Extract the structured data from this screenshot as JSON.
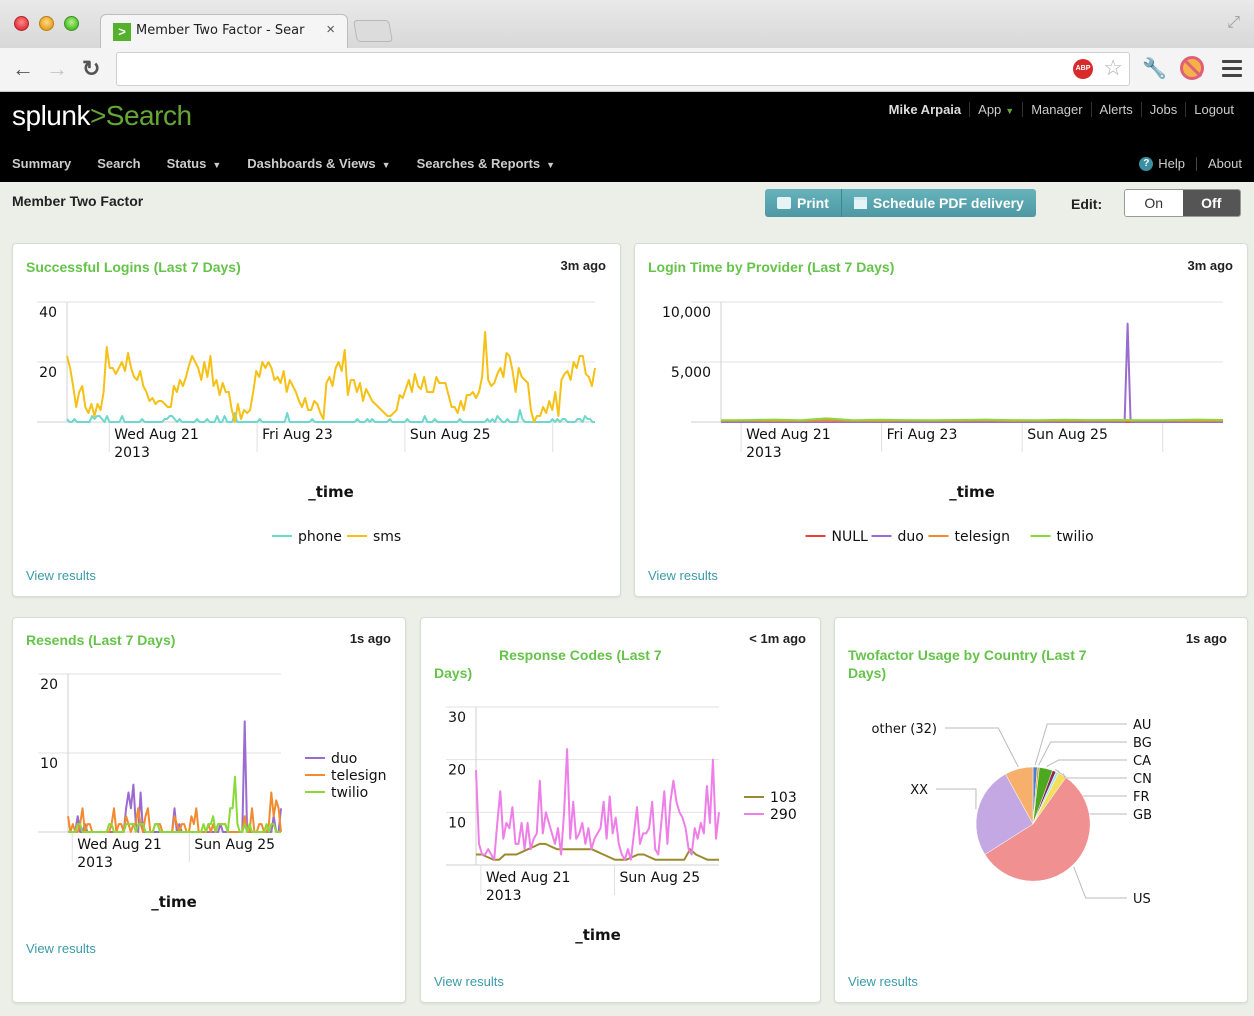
{
  "browser": {
    "tab_title": "Member Two Factor - Sear",
    "tab_close": "×",
    "icons": {
      "back": "arrow-left",
      "forward": "arrow-right",
      "reload": "reload",
      "adblock": "ABP",
      "bookmark": "star",
      "wrench": "wrench",
      "blocked": "blocked-extension",
      "menu": "hamburger",
      "fullscreen": "expand"
    },
    "url": ""
  },
  "header": {
    "logo_text": "splunk",
    "logo_chevron": ">",
    "app_name": "Search",
    "user_links": [
      "Mike Arpaia",
      "App",
      "Manager",
      "Alerts",
      "Jobs",
      "Logout"
    ],
    "nav": [
      "Summary",
      "Search",
      "Status",
      "Dashboards & Views",
      "Searches & Reports"
    ],
    "help": "Help",
    "about": "About"
  },
  "page": {
    "title": "Member Two Factor",
    "print_label": "Print",
    "schedule_label": "Schedule PDF delivery",
    "edit_label": "Edit:",
    "edit_on": "On",
    "edit_off": "Off",
    "edit_state": "Off"
  },
  "panels": [
    {
      "title": "Successful Logins (Last 7 Days)",
      "ago": "3m ago",
      "view_results": "View results",
      "xlabel": "_time"
    },
    {
      "title": "Login Time by Provider (Last 7 Days)",
      "ago": "3m ago",
      "view_results": "View results",
      "xlabel": "_time"
    },
    {
      "title": "Resends (Last 7 Days)",
      "ago": "1s ago",
      "view_results": "View results",
      "xlabel": "_time"
    },
    {
      "title_line1": "Response Codes (Last 7",
      "title_line2": "Days)",
      "ago": "< 1m ago",
      "view_results": "View results",
      "xlabel": "_time"
    },
    {
      "title_line1": "Twofactor Usage by Country (Last 7",
      "title_line2": "Days)",
      "ago": "1s ago",
      "view_results": "View results"
    }
  ],
  "colors": {
    "accent_green": "#65c34a",
    "link_teal": "#3a9aa8",
    "button_teal": "#5aa6b0"
  },
  "chart_data": [
    {
      "type": "line",
      "title": "Successful Logins (Last 7 Days)",
      "xlabel": "_time",
      "ylabel": "",
      "ylim": [
        0,
        40
      ],
      "yticks": [
        "20",
        "40"
      ],
      "xticks": [
        {
          "label": "Wed Aug 21",
          "sub": "2013",
          "pos": 0.08
        },
        {
          "label": "Fri Aug 23",
          "sub": "",
          "pos": 0.36
        },
        {
          "label": "Sun Aug 25",
          "sub": "",
          "pos": 0.64
        },
        {
          "label": "",
          "sub": "",
          "pos": 0.92
        }
      ],
      "legend": "bottom",
      "series": [
        {
          "name": "phone",
          "color": "#6fd8cc",
          "values": [
            1,
            0,
            0,
            1,
            0,
            0,
            0,
            0,
            0,
            0,
            2,
            1,
            2,
            2,
            1,
            0,
            2,
            0,
            0,
            0,
            0,
            0,
            2,
            0,
            0,
            0,
            0,
            0,
            0,
            0,
            1,
            0,
            0,
            0,
            0,
            0,
            0,
            0,
            0,
            1,
            1,
            2,
            2,
            1,
            0,
            1,
            0,
            0,
            0,
            0,
            0,
            0,
            1,
            0,
            0,
            0,
            1,
            0,
            0,
            0,
            2,
            0,
            0,
            2,
            0,
            0,
            0,
            3,
            0,
            0,
            0,
            0,
            0,
            0,
            0,
            0,
            0,
            1,
            0,
            0,
            0,
            0,
            0,
            0,
            0,
            0,
            0,
            0,
            3,
            0,
            0,
            0,
            0,
            0,
            0,
            0,
            0,
            0,
            1,
            0,
            0,
            0,
            0,
            0,
            0,
            0,
            0,
            0,
            0,
            0,
            0,
            0,
            0,
            0,
            0,
            0,
            1,
            0,
            0,
            0,
            1,
            0,
            1,
            0,
            0,
            0,
            0,
            0,
            0,
            1,
            0,
            0,
            0,
            0,
            0,
            0,
            1,
            0,
            0,
            0,
            0,
            0,
            0,
            2,
            0,
            0,
            0,
            1,
            0,
            0,
            0,
            0,
            0,
            0,
            0,
            0,
            0,
            1,
            0,
            0,
            0,
            0,
            0,
            0,
            0,
            0,
            0,
            0,
            1,
            0,
            1,
            0,
            2,
            1,
            0,
            0,
            1,
            0,
            0,
            0,
            0,
            4,
            1,
            0,
            0,
            0,
            0,
            0,
            0,
            0,
            0,
            0,
            0,
            0,
            1,
            0,
            1,
            0,
            1,
            1,
            0,
            0,
            0,
            0,
            1,
            1,
            0,
            2,
            1,
            1,
            0,
            0
          ]
        },
        {
          "name": "sms",
          "color": "#f5c116",
          "values": [
            22,
            18,
            12,
            5,
            10,
            12,
            5,
            3,
            6,
            2,
            6,
            4,
            10,
            25,
            18,
            18,
            16,
            18,
            20,
            17,
            23,
            18,
            15,
            14,
            17,
            12,
            10,
            7,
            8,
            6,
            7,
            7,
            6,
            5,
            5,
            12,
            10,
            14,
            12,
            15,
            19,
            22,
            20,
            18,
            14,
            20,
            15,
            22,
            12,
            14,
            9,
            13,
            10,
            10,
            4,
            0,
            6,
            1,
            4,
            3,
            4,
            10,
            17,
            15,
            20,
            18,
            20,
            18,
            14,
            15,
            13,
            17,
            10,
            14,
            12,
            10,
            7,
            5,
            8,
            4,
            4,
            7,
            6,
            3,
            1,
            13,
            15,
            12,
            18,
            20,
            17,
            24,
            9,
            14,
            14,
            10,
            13,
            7,
            11,
            9,
            7,
            6,
            5,
            4,
            3,
            2,
            2,
            3,
            4,
            9,
            8,
            11,
            14,
            10,
            16,
            12,
            11,
            15,
            10,
            10,
            10,
            15,
            13,
            13,
            13,
            9,
            5,
            5,
            3,
            7,
            4,
            9,
            9,
            10,
            8,
            10,
            15,
            30,
            14,
            12,
            13,
            16,
            18,
            15,
            23,
            22,
            17,
            10,
            18,
            15,
            14,
            13,
            4,
            0,
            2,
            2,
            5,
            3,
            7,
            4,
            10,
            2,
            14,
            16,
            17,
            14,
            20,
            18,
            22,
            22,
            16,
            15,
            12,
            18
          ]
        }
      ]
    },
    {
      "type": "line",
      "title": "Login Time by Provider (Last 7 Days)",
      "xlabel": "_time",
      "ylim": [
        0,
        10000
      ],
      "yticks": [
        "5,000",
        "10,000"
      ],
      "xticks": [
        {
          "label": "Wed Aug 21",
          "sub": "2013",
          "pos": 0.04
        },
        {
          "label": "Fri Aug 23",
          "sub": "",
          "pos": 0.32
        },
        {
          "label": "Sun Aug 25",
          "sub": "",
          "pos": 0.6
        },
        {
          "label": "",
          "sub": "",
          "pos": 0.88
        }
      ],
      "legend": "bottom",
      "series": [
        {
          "name": "NULL",
          "color": "#e8433a",
          "values": [
            0,
            0,
            0,
            0,
            0,
            0,
            0,
            0,
            0,
            0,
            0,
            0,
            0,
            0,
            0,
            0,
            0,
            0,
            0,
            0
          ]
        },
        {
          "name": "duo",
          "color": "#9a6ccf",
          "peak_value": 8200,
          "peak_pos": 0.81
        },
        {
          "name": "telesign",
          "color": "#f28a2e",
          "values": [
            100,
            120,
            90,
            110,
            130,
            100,
            90,
            120,
            110,
            100,
            130,
            90,
            110,
            100,
            120,
            110,
            100,
            120,
            90,
            110
          ]
        },
        {
          "name": "twilio",
          "color": "#8ad93a",
          "values": [
            150,
            160,
            200,
            140,
            300,
            150,
            180,
            160,
            150,
            170,
            200,
            160,
            150,
            180,
            160,
            170,
            150,
            160,
            200,
            170
          ]
        }
      ]
    },
    {
      "type": "line",
      "title": "Resends (Last 7 Days)",
      "xlabel": "_time",
      "ylim": [
        0,
        20
      ],
      "yticks": [
        "10",
        "20"
      ],
      "xticks": [
        {
          "label": "Wed Aug 21",
          "sub": "2013",
          "pos": 0.02
        },
        {
          "label": "Sun Aug 25",
          "sub": "",
          "pos": 0.57
        }
      ],
      "legend": "right",
      "series": [
        {
          "name": "duo",
          "color": "#9a6ccf",
          "values": [
            0,
            0,
            0,
            0,
            2,
            0,
            0,
            1,
            0,
            0,
            0,
            0,
            0,
            0,
            0,
            0,
            0,
            0,
            0,
            0,
            0,
            0,
            0,
            0,
            3,
            5,
            3,
            6,
            1,
            0,
            5,
            0,
            0,
            0,
            0,
            0,
            0,
            0,
            0,
            0,
            0,
            0,
            0,
            0,
            3,
            0,
            1,
            0,
            0,
            0,
            0,
            0,
            0,
            0,
            0,
            0,
            0,
            0,
            0,
            0,
            0,
            0,
            0,
            1,
            0,
            0,
            0,
            0,
            0,
            0,
            0,
            0,
            0,
            14,
            0,
            0,
            0,
            0,
            0,
            0,
            0,
            0,
            0,
            0,
            0,
            2,
            0,
            0,
            3
          ]
        },
        {
          "name": "telesign",
          "color": "#f28a2e",
          "values": [
            2,
            0,
            1,
            0,
            0,
            1,
            3,
            0,
            1,
            1,
            0,
            0,
            0,
            0,
            0,
            0,
            0,
            0,
            1,
            3,
            0,
            1,
            1,
            0,
            2,
            1,
            0,
            1,
            1,
            3,
            1,
            0,
            2,
            3,
            0,
            0,
            1,
            1,
            1,
            0,
            0,
            0,
            0,
            0,
            2,
            1,
            0,
            1,
            1,
            0,
            0,
            2,
            1,
            3,
            0,
            0,
            0,
            0,
            1,
            0,
            1,
            0,
            1,
            1,
            1,
            1,
            0,
            0,
            0,
            0,
            0,
            0,
            0,
            2,
            0,
            0,
            3,
            0,
            0,
            1,
            1,
            0,
            0,
            1,
            5,
            2,
            4,
            3,
            0
          ]
        },
        {
          "name": "twilio",
          "color": "#8ad93a",
          "values": [
            0,
            0,
            0,
            0,
            1,
            1,
            0,
            0,
            0,
            0,
            0,
            0,
            0,
            0,
            0,
            0,
            0,
            1,
            1,
            0,
            0,
            0,
            0,
            0,
            1,
            1,
            1,
            1,
            0,
            1,
            1,
            1,
            0,
            0,
            0,
            0,
            1,
            1,
            0,
            0,
            0,
            0,
            0,
            0,
            0,
            0,
            0,
            0,
            0,
            0,
            0,
            0,
            0,
            0,
            0,
            0,
            1,
            0,
            1,
            1,
            2,
            0,
            1,
            1,
            1,
            1,
            0,
            3,
            3,
            7,
            1,
            0,
            0,
            1,
            0,
            1,
            0,
            0,
            0,
            0,
            0,
            0,
            1,
            0,
            1,
            1,
            0,
            0,
            0
          ]
        }
      ]
    },
    {
      "type": "line",
      "title": "Response Codes (Last 7 Days)",
      "xlabel": "_time",
      "ylim": [
        0,
        30
      ],
      "yticks": [
        "10",
        "20",
        "30"
      ],
      "xticks": [
        {
          "label": "Wed Aug 21",
          "sub": "2013",
          "pos": 0.02
        },
        {
          "label": "Sun Aug 25",
          "sub": "",
          "pos": 0.57
        }
      ],
      "legend": "right",
      "series": [
        {
          "name": "103",
          "color": "#9a8a2e",
          "values": [
            2,
            2,
            1.5,
            1,
            1,
            2,
            2,
            2,
            2.5,
            3,
            3.5,
            4,
            4,
            3.5,
            3,
            3,
            3,
            3,
            3,
            3,
            3,
            2.5,
            2,
            1.5,
            1,
            1,
            1,
            1.5,
            2,
            2,
            1.5,
            1,
            1,
            1,
            1,
            1,
            1,
            3,
            2,
            1.5,
            1,
            1,
            1
          ]
        },
        {
          "name": "290",
          "color": "#ee7ee8",
          "values": [
            18,
            4,
            2,
            2,
            3,
            2,
            1,
            8,
            14,
            5,
            8,
            7,
            11,
            4,
            4,
            8,
            3,
            8,
            3,
            5,
            6,
            16,
            6,
            10,
            8,
            6,
            4,
            7,
            2,
            10,
            22,
            5,
            12,
            5,
            6,
            8,
            4,
            7,
            3,
            5,
            6,
            7,
            12,
            5,
            13,
            6,
            9,
            4,
            2,
            1,
            3,
            1,
            6,
            11,
            4,
            6,
            6,
            7,
            12,
            3,
            2,
            8,
            14,
            4,
            12,
            16,
            12,
            10,
            9,
            7,
            3,
            2,
            7,
            5,
            8,
            6,
            15,
            8,
            20,
            5,
            10
          ]
        }
      ]
    },
    {
      "type": "pie",
      "title": "Twofactor Usage by Country (Last 7 Days)",
      "slices": [
        {
          "label": "AU",
          "value": 1.2,
          "color": "#4a7fd4"
        },
        {
          "label": "BG",
          "value": 0.6,
          "color": "#d9a52a"
        },
        {
          "label": "CA",
          "value": 3.8,
          "color": "#4ea81f"
        },
        {
          "label": "CN",
          "value": 1.0,
          "color": "#8a2a5a"
        },
        {
          "label": "FR",
          "value": 0.8,
          "color": "#a9e3f0"
        },
        {
          "label": "GB",
          "value": 2.4,
          "color": "#f2e05a"
        },
        {
          "label": "US",
          "value": 56.2,
          "color": "#f09090"
        },
        {
          "label": "XX",
          "value": 26.0,
          "color": "#c4a8e4"
        },
        {
          "label": "other (32)",
          "value": 8.0,
          "color": "#f7b06c"
        }
      ]
    }
  ]
}
